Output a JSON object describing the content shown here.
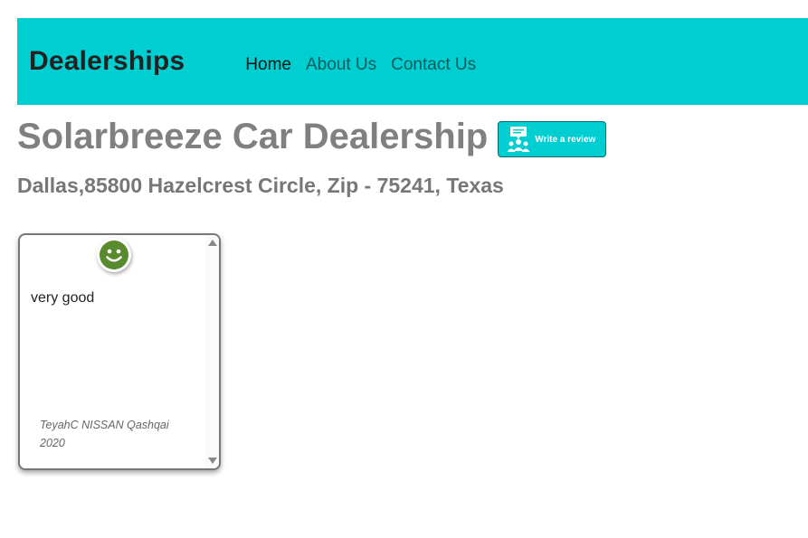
{
  "navbar": {
    "brand": "Dealerships",
    "links": [
      {
        "label": "Home",
        "active": true
      },
      {
        "label": "About Us",
        "active": false
      },
      {
        "label": "Contact Us",
        "active": false
      }
    ],
    "background_color": "#00ced1"
  },
  "dealer": {
    "name": "Solarbreeze Car Dealership",
    "address": "Dallas,85800 Hazelcrest Circle, Zip - 75241, Texas"
  },
  "review_button": {
    "label": "Write a review",
    "icon": "review-people-icon"
  },
  "reviews": [
    {
      "sentiment_icon": "smiley-icon",
      "sentiment_color": "#5a8a2e",
      "text": "very good",
      "reviewer_line1": "TeyahC NISSAN Qashqai",
      "reviewer_line2": "2020"
    }
  ]
}
